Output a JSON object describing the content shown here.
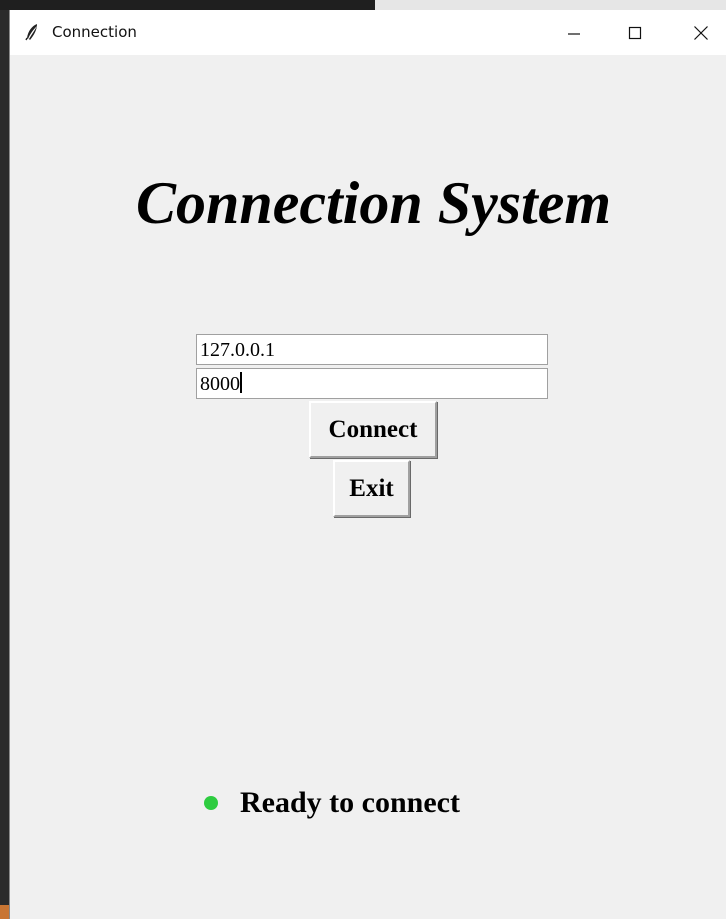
{
  "window": {
    "title": "Connection",
    "icon": "feather-icon",
    "controls": [
      "minimize-icon",
      "maximize-icon",
      "close-icon"
    ]
  },
  "heading": "Connection System",
  "form": {
    "host_value": "127.0.0.1",
    "port_value": "8000"
  },
  "buttons": {
    "connect_label": "Connect",
    "exit_label": "Exit"
  },
  "status": {
    "text": "Ready to connect",
    "indicator_color": "#2ecc40"
  },
  "colors": {
    "window_background": "#f0f0f0",
    "titlebar_background": "#ffffff"
  }
}
